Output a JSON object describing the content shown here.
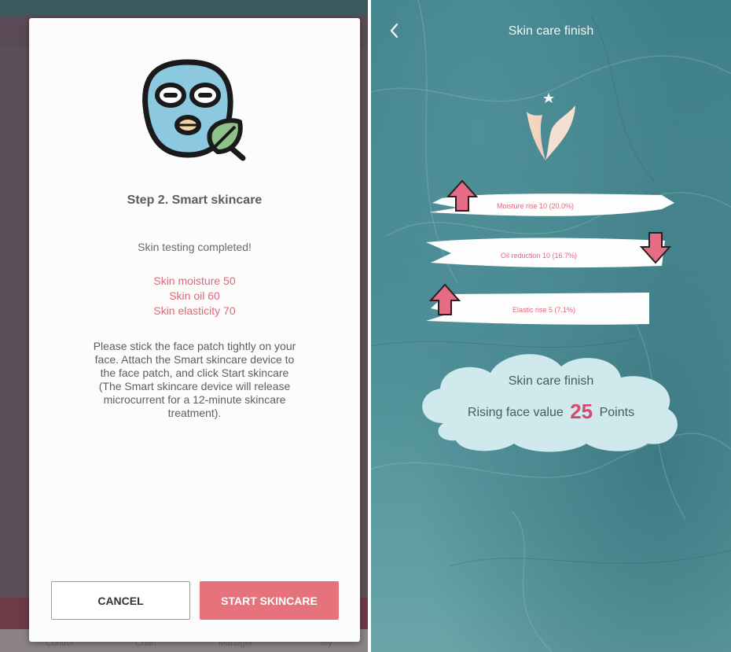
{
  "left_panel": {
    "dialog": {
      "title": "Step 2. Smart skincare",
      "status_text": "Skin testing completed!",
      "metrics": [
        "Skin moisture 50",
        "Skin oil 60",
        "Skin elasticity 70"
      ],
      "instruction_lines": [
        "Please stick the face patch tightly on your",
        "face. Attach the Smart skincare device to",
        "the face patch, and click Start skincare",
        "(The Smart skincare device will release",
        "microcurrent for a 12-minute skincare",
        "treatment)."
      ],
      "cancel_label": "CANCEL",
      "start_label": "START SKINCARE",
      "icon": "face-mask-leaf-icon"
    },
    "tab_labels": [
      "Control",
      "Chart",
      "Manager",
      "My"
    ]
  },
  "right_panel": {
    "header": {
      "title": "Skin care finish",
      "back_icon": "chevron-left-icon"
    },
    "results": [
      {
        "text": "Moisture rise 10 (20.0%)",
        "direction": "up"
      },
      {
        "text": "Oil reduction 10 (16.7%)",
        "direction": "down"
      },
      {
        "text": "Elastic rise 5 (7.1%)",
        "direction": "up"
      }
    ],
    "summary": {
      "title": "Skin care finish",
      "prefix": "Rising face value",
      "points": "25",
      "suffix": "Points"
    }
  },
  "colors": {
    "accent_pink": "#e0677a",
    "button_pink": "#e6737c",
    "points_color": "#d24a6e",
    "teal_bg": "#4a8b94"
  }
}
